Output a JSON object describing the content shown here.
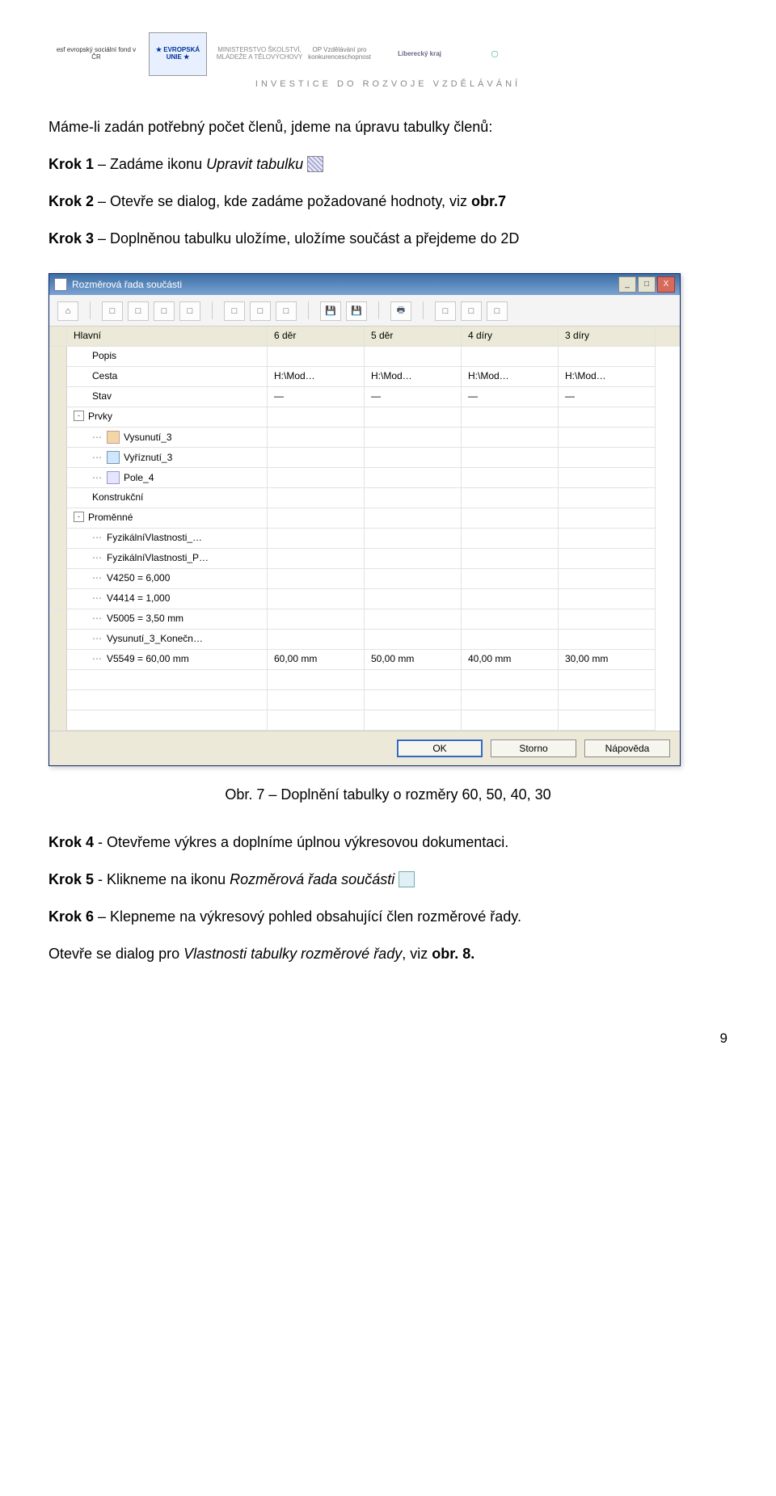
{
  "logos": {
    "esf": "esf evropský sociální fond v ČR",
    "eu": "★ EVROPSKÁ UNIE ★",
    "ms": "MINISTERSTVO ŠKOLSTVÍ, MLÁDEŽE A TĚLOVÝCHOVY",
    "op": "OP Vzdělávání pro konkurenceschopnost",
    "lk": "Liberecký kraj",
    "globe": "◯"
  },
  "tagline": "INVESTICE DO ROZVOJE VZDĚLÁVÁNÍ",
  "p_intro": "Máme-li zadán potřebný počet členů, jdeme na úpravu tabulky členů:",
  "s1": {
    "b": "Krok 1",
    "t1": " – Zadáme ikonu ",
    "i": "Upravit tabulku",
    "sp": " "
  },
  "s2": {
    "b": "Krok 2",
    "t1": " – Otevře se dialog, kde zadáme požadované hodnoty, viz ",
    "b2": "obr.7"
  },
  "s3": {
    "b": "Krok 3",
    "t1": " – Doplněnou tabulku uložíme, uložíme součást a přejdeme do 2D"
  },
  "window": {
    "title": "Rozměrová řada součásti",
    "winbtn_min": "_",
    "winbtn_max": "□",
    "winbtn_close": "X",
    "tb": {
      "home": "⌂",
      "a": "□",
      "b": "□",
      "c": "□",
      "d": "□",
      "e": "□",
      "f": "□",
      "g": "□",
      "save": "💾",
      "saveas": "💾",
      "print": "🖶",
      "h": "□",
      "i": "□",
      "j": "□"
    },
    "headers": [
      "",
      "Hlavní",
      "6 děr",
      "5 děr",
      "4 díry",
      "3 díry"
    ],
    "rows": [
      {
        "indent": 1,
        "toggle": "",
        "icon": "",
        "label": "Popis",
        "v": [
          "",
          "",
          "",
          ""
        ]
      },
      {
        "indent": 1,
        "toggle": "",
        "icon": "",
        "label": "Cesta",
        "v": [
          "H:\\Mod…",
          "H:\\Mod…",
          "H:\\Mod…",
          "H:\\Mod…"
        ]
      },
      {
        "indent": 1,
        "toggle": "",
        "icon": "",
        "label": "Stav",
        "v": [
          "—",
          "—",
          "—",
          "—"
        ]
      },
      {
        "indent": 0,
        "toggle": "-",
        "icon": "",
        "label": "Prvky",
        "v": [
          "",
          "",
          "",
          ""
        ]
      },
      {
        "indent": 2,
        "toggle": "",
        "icon": "cube",
        "label": "Vysunutí_3",
        "v": [
          "",
          "",
          "",
          ""
        ]
      },
      {
        "indent": 2,
        "toggle": "",
        "icon": "cut",
        "label": "Vyříznutí_3",
        "v": [
          "",
          "",
          "",
          ""
        ]
      },
      {
        "indent": 2,
        "toggle": "",
        "icon": "array",
        "label": "Pole_4",
        "v": [
          "",
          "",
          "",
          ""
        ]
      },
      {
        "indent": 1,
        "toggle": "",
        "icon": "",
        "label": "Konstrukční",
        "v": [
          "",
          "",
          "",
          ""
        ]
      },
      {
        "indent": 0,
        "toggle": "-",
        "icon": "",
        "label": "Proměnné",
        "v": [
          "",
          "",
          "",
          ""
        ]
      },
      {
        "indent": 2,
        "toggle": "",
        "icon": "",
        "label": "FyzikálníVlastnosti_…",
        "v": [
          "",
          "",
          "",
          ""
        ]
      },
      {
        "indent": 2,
        "toggle": "",
        "icon": "",
        "label": "FyzikálníVlastnosti_P…",
        "v": [
          "",
          "",
          "",
          ""
        ]
      },
      {
        "indent": 2,
        "toggle": "",
        "icon": "",
        "label": "V4250 = 6,000",
        "v": [
          "",
          "",
          "",
          ""
        ]
      },
      {
        "indent": 2,
        "toggle": "",
        "icon": "",
        "label": "V4414 = 1,000",
        "v": [
          "",
          "",
          "",
          ""
        ]
      },
      {
        "indent": 2,
        "toggle": "",
        "icon": "",
        "label": "V5005 = 3,50 mm",
        "v": [
          "",
          "",
          "",
          ""
        ]
      },
      {
        "indent": 2,
        "toggle": "",
        "icon": "",
        "label": "Vysunutí_3_Konečn…",
        "v": [
          "",
          "",
          "",
          ""
        ]
      },
      {
        "indent": 2,
        "toggle": "",
        "icon": "",
        "label": "V5549 = 60,00 mm",
        "v": [
          "60,00 mm",
          "50,00 mm",
          "40,00 mm",
          "30,00 mm"
        ]
      },
      {
        "blank": true
      },
      {
        "blank": true
      },
      {
        "blank": true
      }
    ],
    "buttons": {
      "ok": "OK",
      "cancel": "Storno",
      "help": "Nápověda"
    }
  },
  "caption": "Obr. 7 – Doplnění tabulky o rozměry 60, 50, 40, 30",
  "s4": {
    "b": "Krok 4",
    "t": " - Otevřeme výkres a doplníme úplnou výkresovou dokumentaci."
  },
  "s5": {
    "b": "Krok 5",
    "t1": " - Klikneme na ikonu ",
    "i": "Rozměrová řada součásti",
    "sp": " "
  },
  "s6": {
    "b": "Krok 6",
    "t": " – Klepneme na výkresový pohled obsahující člen rozměrové řady."
  },
  "p_outro1": "Otevře se dialog pro ",
  "p_outro_i": "Vlastnosti tabulky rozměrové řady",
  "p_outro2": ", viz ",
  "p_outro_b": "obr. 8.",
  "page_number": "9"
}
